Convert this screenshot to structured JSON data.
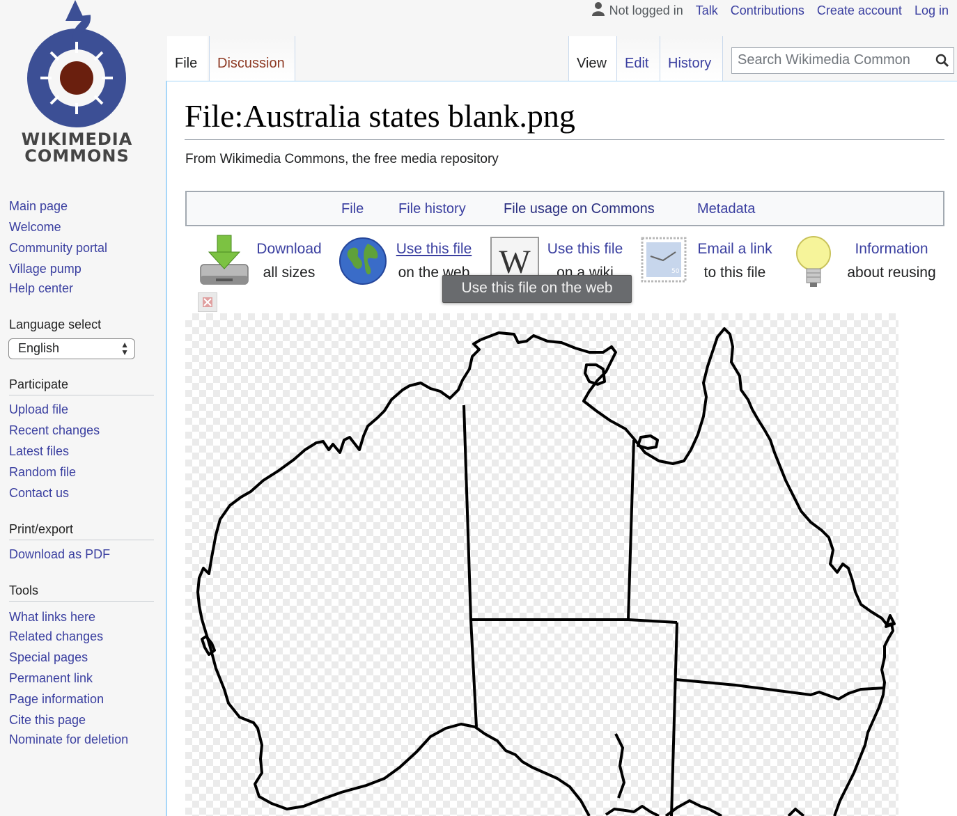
{
  "logo": {
    "line1": "WIKIMEDIA",
    "line2": "COMMONS"
  },
  "personal": {
    "status": "Not logged in",
    "talk": "Talk",
    "contributions": "Contributions",
    "create_account": "Create account",
    "log_in": "Log in"
  },
  "tabs": {
    "file": "File",
    "discussion": "Discussion",
    "view": "View",
    "edit": "Edit",
    "history": "History"
  },
  "search": {
    "placeholder": "Search Wikimedia Common"
  },
  "sidebar": {
    "nav": [
      "Main page",
      "Welcome",
      "Community portal",
      "Village pump",
      "Help center"
    ],
    "language_heading": "Language select",
    "language_value": "English",
    "participate_heading": "Participate",
    "participate": [
      "Upload file",
      "Recent changes",
      "Latest files",
      "Random file",
      "Contact us"
    ],
    "print_heading": "Print/export",
    "print": [
      "Download as PDF"
    ],
    "tools_heading": "Tools",
    "tools": [
      "What links here",
      "Related changes",
      "Special pages",
      "Permanent link",
      "Page information",
      "Cite this page",
      "Nominate for deletion"
    ]
  },
  "page": {
    "title": "File:Australia states blank.png",
    "tagline": "From Wikimedia Commons, the free media repository"
  },
  "file_toc": [
    "File",
    "File history",
    "File usage on Commons",
    "Metadata"
  ],
  "tools": {
    "download": {
      "line1": "Download",
      "line2": "all sizes"
    },
    "use_web": {
      "line1": "Use this file",
      "line2": "on the web"
    },
    "use_wiki": {
      "line1": "Use this file",
      "line2": "on a wiki"
    },
    "email": {
      "line1": "Email a link",
      "line2": "to this file"
    },
    "info": {
      "line1": "Information",
      "line2": "about reusing"
    },
    "tooltip": "Use this file on the web"
  },
  "colors": {
    "link": "#3a3fa0",
    "new_link": "#8e3a24",
    "tab_border": "#a7d7f9",
    "logo_blue": "#3c4f95",
    "logo_red": "#6a1f0e"
  }
}
